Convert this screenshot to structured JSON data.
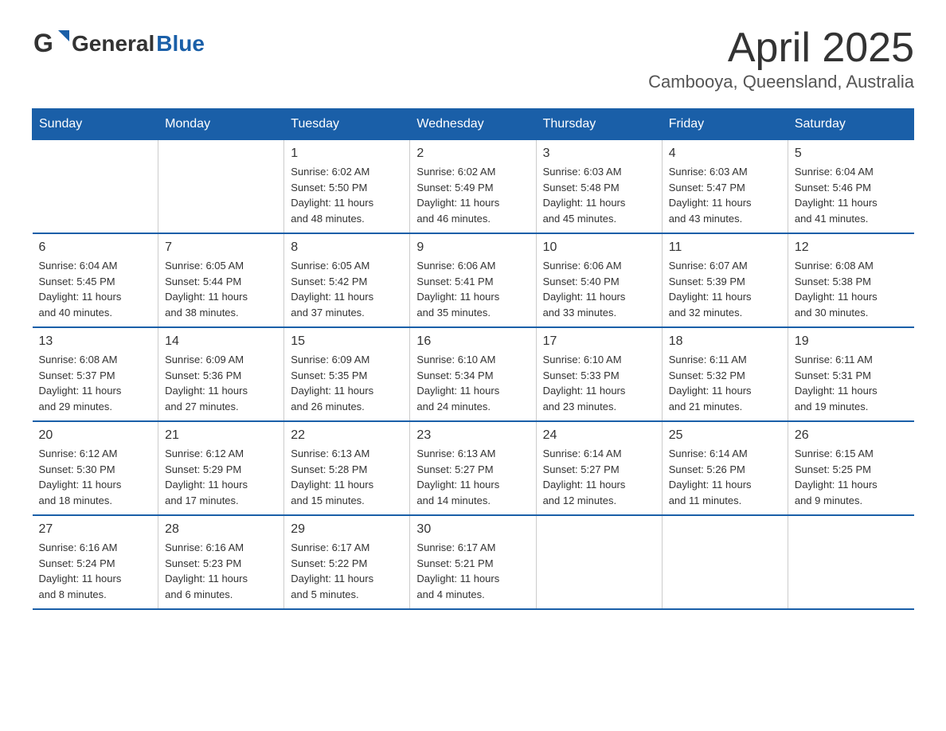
{
  "header": {
    "logo": {
      "general": "General",
      "blue": "Blue"
    },
    "title": "April 2025",
    "location": "Cambooya, Queensland, Australia"
  },
  "calendar": {
    "days_of_week": [
      "Sunday",
      "Monday",
      "Tuesday",
      "Wednesday",
      "Thursday",
      "Friday",
      "Saturday"
    ],
    "weeks": [
      [
        {
          "day": "",
          "info": ""
        },
        {
          "day": "",
          "info": ""
        },
        {
          "day": "1",
          "info": "Sunrise: 6:02 AM\nSunset: 5:50 PM\nDaylight: 11 hours\nand 48 minutes."
        },
        {
          "day": "2",
          "info": "Sunrise: 6:02 AM\nSunset: 5:49 PM\nDaylight: 11 hours\nand 46 minutes."
        },
        {
          "day": "3",
          "info": "Sunrise: 6:03 AM\nSunset: 5:48 PM\nDaylight: 11 hours\nand 45 minutes."
        },
        {
          "day": "4",
          "info": "Sunrise: 6:03 AM\nSunset: 5:47 PM\nDaylight: 11 hours\nand 43 minutes."
        },
        {
          "day": "5",
          "info": "Sunrise: 6:04 AM\nSunset: 5:46 PM\nDaylight: 11 hours\nand 41 minutes."
        }
      ],
      [
        {
          "day": "6",
          "info": "Sunrise: 6:04 AM\nSunset: 5:45 PM\nDaylight: 11 hours\nand 40 minutes."
        },
        {
          "day": "7",
          "info": "Sunrise: 6:05 AM\nSunset: 5:44 PM\nDaylight: 11 hours\nand 38 minutes."
        },
        {
          "day": "8",
          "info": "Sunrise: 6:05 AM\nSunset: 5:42 PM\nDaylight: 11 hours\nand 37 minutes."
        },
        {
          "day": "9",
          "info": "Sunrise: 6:06 AM\nSunset: 5:41 PM\nDaylight: 11 hours\nand 35 minutes."
        },
        {
          "day": "10",
          "info": "Sunrise: 6:06 AM\nSunset: 5:40 PM\nDaylight: 11 hours\nand 33 minutes."
        },
        {
          "day": "11",
          "info": "Sunrise: 6:07 AM\nSunset: 5:39 PM\nDaylight: 11 hours\nand 32 minutes."
        },
        {
          "day": "12",
          "info": "Sunrise: 6:08 AM\nSunset: 5:38 PM\nDaylight: 11 hours\nand 30 minutes."
        }
      ],
      [
        {
          "day": "13",
          "info": "Sunrise: 6:08 AM\nSunset: 5:37 PM\nDaylight: 11 hours\nand 29 minutes."
        },
        {
          "day": "14",
          "info": "Sunrise: 6:09 AM\nSunset: 5:36 PM\nDaylight: 11 hours\nand 27 minutes."
        },
        {
          "day": "15",
          "info": "Sunrise: 6:09 AM\nSunset: 5:35 PM\nDaylight: 11 hours\nand 26 minutes."
        },
        {
          "day": "16",
          "info": "Sunrise: 6:10 AM\nSunset: 5:34 PM\nDaylight: 11 hours\nand 24 minutes."
        },
        {
          "day": "17",
          "info": "Sunrise: 6:10 AM\nSunset: 5:33 PM\nDaylight: 11 hours\nand 23 minutes."
        },
        {
          "day": "18",
          "info": "Sunrise: 6:11 AM\nSunset: 5:32 PM\nDaylight: 11 hours\nand 21 minutes."
        },
        {
          "day": "19",
          "info": "Sunrise: 6:11 AM\nSunset: 5:31 PM\nDaylight: 11 hours\nand 19 minutes."
        }
      ],
      [
        {
          "day": "20",
          "info": "Sunrise: 6:12 AM\nSunset: 5:30 PM\nDaylight: 11 hours\nand 18 minutes."
        },
        {
          "day": "21",
          "info": "Sunrise: 6:12 AM\nSunset: 5:29 PM\nDaylight: 11 hours\nand 17 minutes."
        },
        {
          "day": "22",
          "info": "Sunrise: 6:13 AM\nSunset: 5:28 PM\nDaylight: 11 hours\nand 15 minutes."
        },
        {
          "day": "23",
          "info": "Sunrise: 6:13 AM\nSunset: 5:27 PM\nDaylight: 11 hours\nand 14 minutes."
        },
        {
          "day": "24",
          "info": "Sunrise: 6:14 AM\nSunset: 5:27 PM\nDaylight: 11 hours\nand 12 minutes."
        },
        {
          "day": "25",
          "info": "Sunrise: 6:14 AM\nSunset: 5:26 PM\nDaylight: 11 hours\nand 11 minutes."
        },
        {
          "day": "26",
          "info": "Sunrise: 6:15 AM\nSunset: 5:25 PM\nDaylight: 11 hours\nand 9 minutes."
        }
      ],
      [
        {
          "day": "27",
          "info": "Sunrise: 6:16 AM\nSunset: 5:24 PM\nDaylight: 11 hours\nand 8 minutes."
        },
        {
          "day": "28",
          "info": "Sunrise: 6:16 AM\nSunset: 5:23 PM\nDaylight: 11 hours\nand 6 minutes."
        },
        {
          "day": "29",
          "info": "Sunrise: 6:17 AM\nSunset: 5:22 PM\nDaylight: 11 hours\nand 5 minutes."
        },
        {
          "day": "30",
          "info": "Sunrise: 6:17 AM\nSunset: 5:21 PM\nDaylight: 11 hours\nand 4 minutes."
        },
        {
          "day": "",
          "info": ""
        },
        {
          "day": "",
          "info": ""
        },
        {
          "day": "",
          "info": ""
        }
      ]
    ]
  }
}
